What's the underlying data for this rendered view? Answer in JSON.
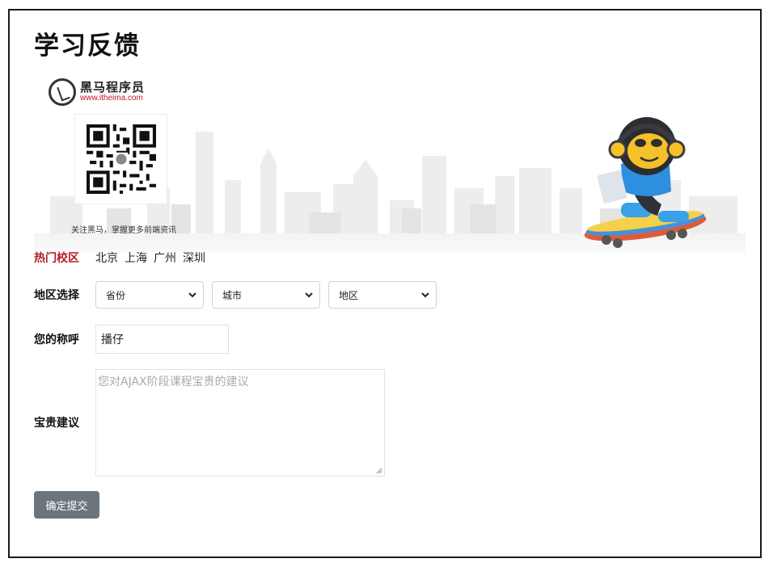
{
  "page": {
    "title": "学习反馈"
  },
  "banner": {
    "logo_name": "黑马程序员",
    "logo_url": "www.itheima.com",
    "qr_caption": "关注黑马，掌握更多前端资讯"
  },
  "campus": {
    "label": "热门校区",
    "cities": [
      "北京",
      "上海",
      "广州",
      "深圳"
    ]
  },
  "region": {
    "label": "地区选择",
    "province": "省份",
    "city": "城市",
    "district": "地区"
  },
  "name": {
    "label": "您的称呼",
    "value": "播仔"
  },
  "suggestion": {
    "label": "宝贵建议",
    "placeholder": "您对AJAX阶段课程宝贵的建议"
  },
  "submit": {
    "label": "确定提交"
  },
  "colors": {
    "hot_label": "#b21d26",
    "button": "#6c757d"
  }
}
